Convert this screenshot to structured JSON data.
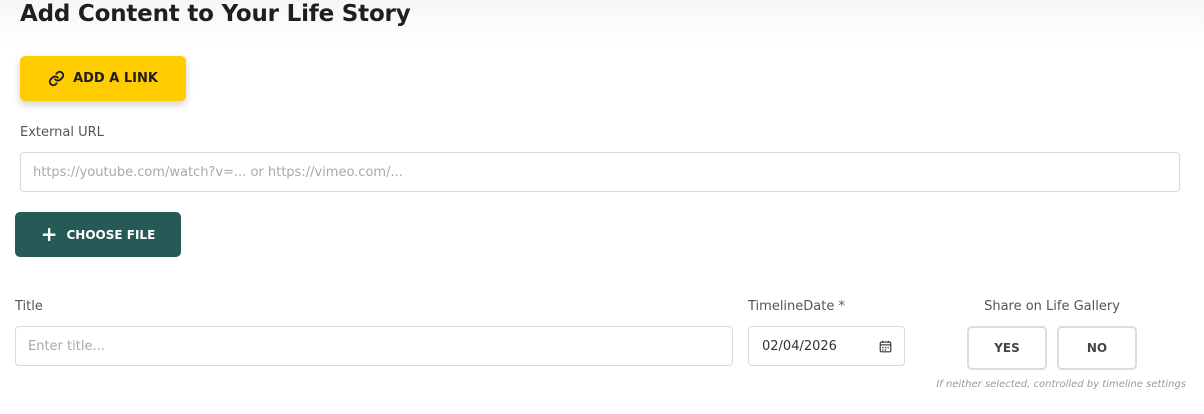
{
  "page": {
    "title": "Add Content to Your Life Story"
  },
  "link_button": {
    "label": "ADD A LINK",
    "icon": "link-icon"
  },
  "external_url": {
    "label": "External URL",
    "placeholder": "https://youtube.com/watch?v=... or https://vimeo.com/...",
    "value": ""
  },
  "file_button": {
    "label": "CHOOSE FILE",
    "icon": "plus-icon"
  },
  "title_field": {
    "label": "Title",
    "placeholder": "Enter title...",
    "value": ""
  },
  "timeline_date": {
    "label": "TimelineDate *",
    "value": "02/04/2026",
    "icon": "calendar-icon"
  },
  "share": {
    "label": "Share on Life Gallery",
    "yes_label": "YES",
    "no_label": "NO",
    "hint": "If neither selected, controlled by timeline settings"
  },
  "colors": {
    "accent_yellow": "#ffcc00",
    "primary_teal": "#265a57"
  }
}
